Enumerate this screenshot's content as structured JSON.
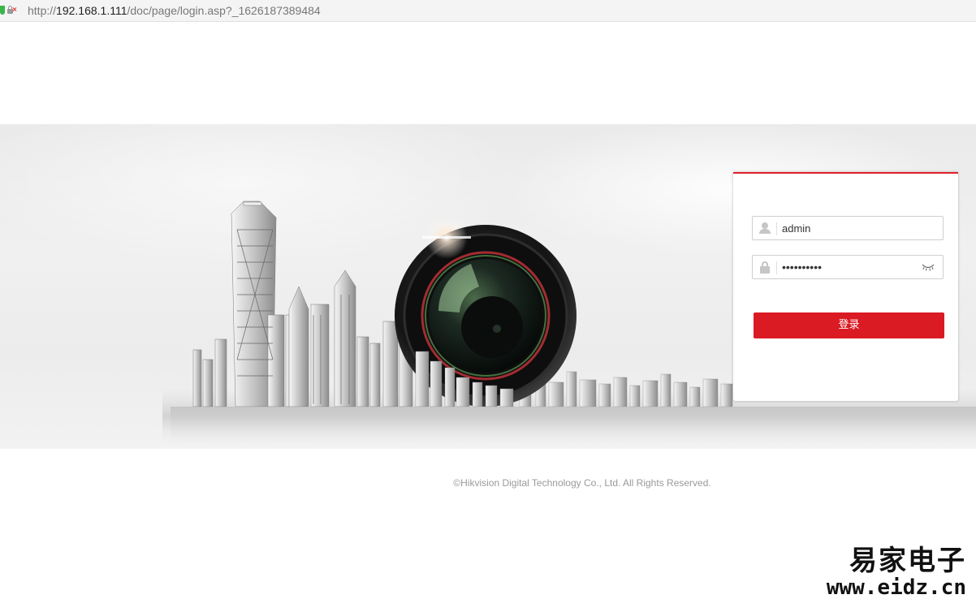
{
  "browser": {
    "url_prefix": "http://",
    "url_host": "192.168.1.111",
    "url_path": "/doc/page/login.asp?_1626187389484"
  },
  "login": {
    "username_value": "admin",
    "password_value": "••••••••••",
    "submit_label": "登录"
  },
  "footer": {
    "copyright": "©Hikvision Digital Technology Co., Ltd. All Rights Reserved."
  },
  "watermark": {
    "brand_cn": "易家电子",
    "brand_url": "www.eidz.cn"
  },
  "icons": {
    "user": "user-icon",
    "lock": "lock-icon",
    "eye": "eye-closed-icon",
    "site_security": "shield-icon"
  },
  "colors": {
    "accent": "#da1b23",
    "panel_border": "#e0202a"
  }
}
